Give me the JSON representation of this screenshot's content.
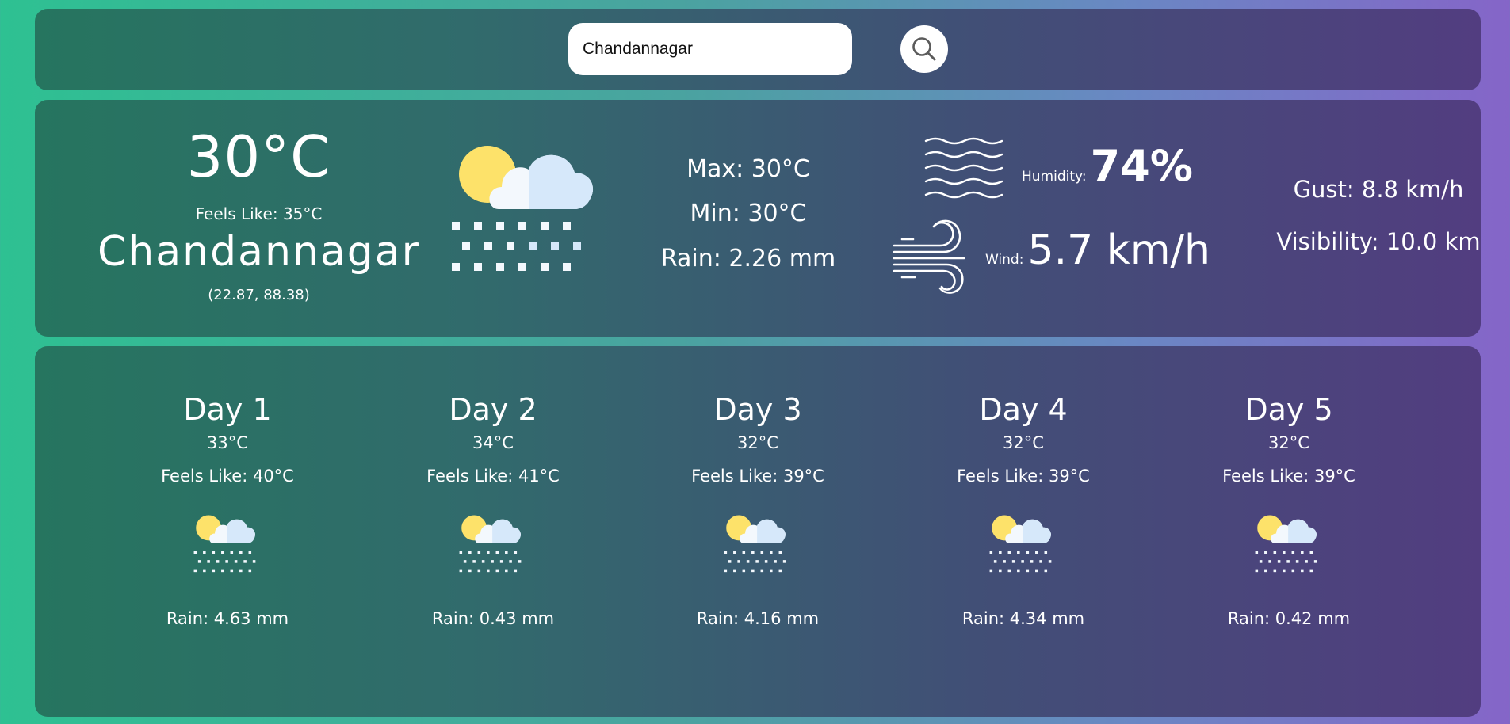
{
  "search": {
    "value": "Chandannagar",
    "button_icon": "search-icon"
  },
  "current": {
    "temperature": "30°C",
    "feels_like": "Feels Like: 35°C",
    "city": "Chandannagar",
    "coordinates": "(22.87, 88.38)",
    "condition_icon": "sun-cloud-snow-icon",
    "max": "Max: 30°C",
    "min": "Min: 30°C",
    "rain": "Rain: 2.26 mm",
    "humidity_label": "Humidity:",
    "humidity_value": "74%",
    "humidity_icon": "humidity-waves-icon",
    "wind_label": "Wind:",
    "wind_value": "5.7 km/h",
    "wind_icon": "wind-icon",
    "gust": "Gust: 8.8 km/h",
    "visibility": "Visibility: 10.0 km"
  },
  "forecast": [
    {
      "day": "Day 1",
      "temp": "33°C",
      "feels_like": "Feels Like: 40°C",
      "rain": "Rain: 4.63 mm",
      "icon": "sun-cloud-snow-icon"
    },
    {
      "day": "Day 2",
      "temp": "34°C",
      "feels_like": "Feels Like: 41°C",
      "rain": "Rain: 0.43 mm",
      "icon": "sun-cloud-snow-icon"
    },
    {
      "day": "Day 3",
      "temp": "32°C",
      "feels_like": "Feels Like: 39°C",
      "rain": "Rain: 4.16 mm",
      "icon": "sun-cloud-snow-icon"
    },
    {
      "day": "Day 4",
      "temp": "32°C",
      "feels_like": "Feels Like: 39°C",
      "rain": "Rain: 4.34 mm",
      "icon": "sun-cloud-snow-icon"
    },
    {
      "day": "Day 5",
      "temp": "32°C",
      "feels_like": "Feels Like: 39°C",
      "rain": "Rain: 0.42 mm",
      "icon": "sun-cloud-snow-icon"
    }
  ],
  "colors": {
    "sun": "#fde26a",
    "cloud_light": "#f3f8fd",
    "cloud_shade": "#d6e8fa"
  }
}
